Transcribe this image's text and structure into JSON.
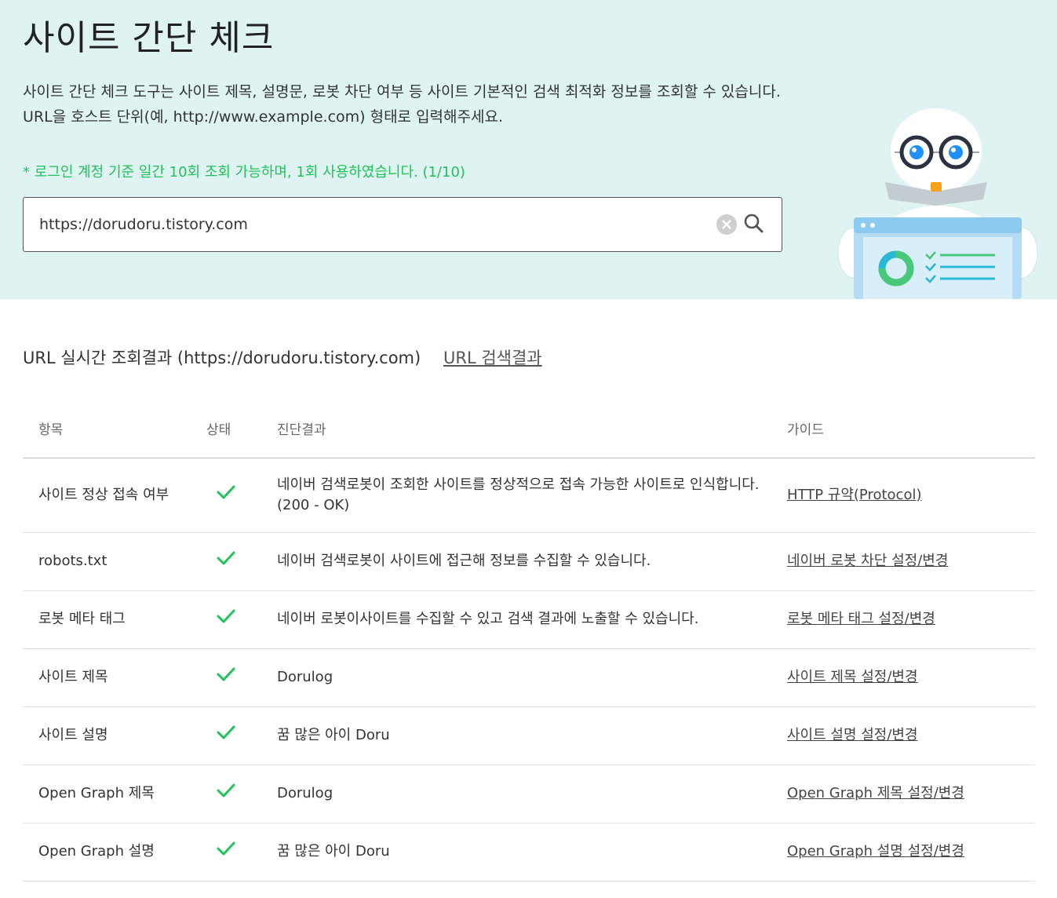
{
  "header": {
    "title": "사이트 간단 체크",
    "desc_line1": "사이트 간단 체크 도구는 사이트 제목, 설명문, 로봇 차단 여부 등 사이트 기본적인 검색 최적화 정보를 조회할 수 있습니다.",
    "desc_line2": "URL을 호스트 단위(예, http://www.example.com) 형태로 입력해주세요.",
    "notice": "* 로그인 계정 기준 일간 10회 조회 가능하며, 1회 사용하였습니다. (1/10)"
  },
  "search": {
    "value": "https://dorudoru.tistory.com"
  },
  "result": {
    "heading": "URL 실시간 조회결과 (https://dorudoru.tistory.com)",
    "search_link": "URL 검색결과"
  },
  "table": {
    "headers": [
      "항목",
      "상태",
      "진단결과",
      "가이드"
    ],
    "rows": [
      {
        "item": "사이트 정상 접속 여부",
        "status": "ok",
        "result_line1": "네이버 검색로봇이 조회한 사이트를 정상적으로 접속 가능한 사이트로 인식합니다.",
        "result_line2": "(200 - OK)",
        "guide": "HTTP 규약(Protocol)"
      },
      {
        "item": "robots.txt",
        "status": "ok",
        "result_line1": "네이버 검색로봇이 사이트에 접근해 정보를 수집할 수 있습니다.",
        "guide": "네이버 로봇 차단 설정/변경"
      },
      {
        "item": "로봇 메타 태그",
        "status": "ok",
        "result_line1": "네이버 로봇이사이트를 수집할 수 있고 검색 결과에 노출할 수 있습니다.",
        "guide": "로봇 메타 태그 설정/변경"
      },
      {
        "item": "사이트 제목",
        "status": "ok",
        "result_line1": "Dorulog",
        "guide": "사이트 제목 설정/변경"
      },
      {
        "item": "사이트 설명",
        "status": "ok",
        "result_line1": "꿈 많은 아이 Doru",
        "guide": "사이트 설명 설정/변경"
      },
      {
        "item": "Open Graph 제목",
        "status": "ok",
        "result_line1": "Dorulog",
        "guide": "Open Graph 제목 설정/변경"
      },
      {
        "item": "Open Graph 설명",
        "status": "ok",
        "result_line1": "꿈 많은 아이 Doru",
        "guide": "Open Graph 설명 설정/변경"
      }
    ]
  },
  "colors": {
    "hero_bg": "#dff3f2",
    "notice_green": "#1fc35a",
    "check_green": "#1fc35a"
  },
  "icons": {
    "clear": "clear-icon",
    "search": "search-icon",
    "status_ok": "check-icon",
    "illustration": "robot-illustration"
  }
}
